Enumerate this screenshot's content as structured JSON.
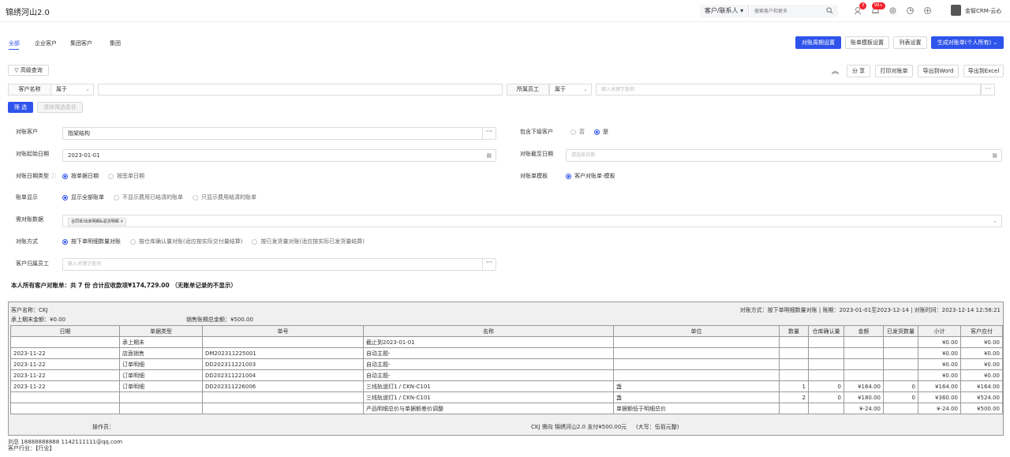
{
  "app": {
    "title": "锦绣河山2.0"
  },
  "topbar": {
    "search_type": "客户/联系人",
    "search_placeholder": "搜索客户和更多",
    "badge_todo": "3",
    "badge_notice": "99+",
    "user_name": "金智CRM-云心"
  },
  "tabs": [
    "全部",
    "企业客户",
    "集团客户",
    "集团"
  ],
  "actions": {
    "period_settings": "对账周期设置",
    "template_settings": "账单模板设置",
    "list_settings": "列表设置",
    "generate": "生成对账单(个人所有)",
    "advanced_query": "高级查询",
    "share": "分 享",
    "print": "打印对账单",
    "export_word": "导出到Word",
    "export_excel": "导出到Excel"
  },
  "filters": {
    "customer_label": "客户名称",
    "customer_op": "属于",
    "staff_label": "所属员工",
    "staff_op": "属于",
    "staff_placeholder": "输入关键字查询",
    "filter_btn": "筛 选",
    "clear_btn": "清除筛选条件"
  },
  "form": {
    "customer_label": "对账客户",
    "customer_value": "指架结构",
    "include_sub_label": "包含下级客户",
    "include_sub_no": "否",
    "include_sub_yes": "是",
    "start_date_label": "对账起始日期",
    "start_date_value": "2023-01-01",
    "end_date_label": "对账截至日期",
    "end_date_placeholder": "请选择日期",
    "date_type_label": "对账日期类型",
    "date_type_opt1": "按单据日期",
    "date_type_opt2": "按签单日期",
    "template_label": "对账单模板",
    "template_value": "客户对账单-模板",
    "display_label": "账单显示",
    "display_opt1": "显示全部账单",
    "display_opt2": "不显示费用已结清的账单",
    "display_opt3": "只显示费用结清的账单",
    "data_label": "需对账数据",
    "data_tag": "合同单/出库明细&退货明细",
    "method_label": "对账方式",
    "method_opt1": "按下单明细数量对账",
    "method_opt2": "按仓库确认量对账(适应按实际交付量结算)",
    "method_opt3": "按已发货量对账(适应按实际已发货量结算)",
    "owner_label": "客户归属员工",
    "owner_placeholder": "输入关键字查询"
  },
  "summary": "本人所有客户对账单：共 7 份  合计应收款项¥174,729.00  （无账单记录的不显示）",
  "statement": {
    "customer": "客户名称：CKJ",
    "method_info": "对账方式：按下单明细数量对账 | 账期：2023-01-01至2023-12-14 | 对账时间：2023-12-14 12:58:21",
    "prev_balance": "承上期末金额：¥0.00",
    "total_sales": "销售账期总金额：¥500.00",
    "headers": [
      "日期",
      "单据类型",
      "单号",
      "名称",
      "单位",
      "数量",
      "仓库确认量",
      "金额",
      "已发货数量",
      "小计",
      "客户应付"
    ],
    "rows": [
      [
        "",
        "承上期末",
        "",
        "截止到2023-01-01",
        "",
        "",
        "",
        "",
        "",
        "¥0.00",
        "¥0.00"
      ],
      [
        "2023-11-22",
        "店面销售",
        "DM202311225001",
        "自动主题-",
        "",
        "",
        "",
        "",
        "",
        "¥0.00",
        "¥0.00"
      ],
      [
        "2023-11-22",
        "订单明细",
        "DD202311221003",
        "自动主题-",
        "",
        "",
        "",
        "",
        "",
        "¥0.00",
        "¥0.00"
      ],
      [
        "2023-11-22",
        "订单明细",
        "DD202311221004",
        "自动主题-",
        "",
        "",
        "",
        "",
        "",
        "¥0.00",
        "¥0.00"
      ],
      [
        "2023-11-22",
        "订单明细",
        "DD202311226006",
        "三线轨道灯1 / CKN-C101",
        "盏",
        "1",
        "0",
        "¥164.00",
        "0",
        "¥164.00",
        "¥164.00"
      ],
      [
        "",
        "",
        "",
        "三线轨道灯1 / CKN-C101",
        "盏",
        "2",
        "0",
        "¥180.00",
        "0",
        "¥360.00",
        "¥524.00"
      ],
      [
        "",
        "",
        "",
        "产品明细总价与单据额差价调整",
        "单据额低于明细总价",
        "",
        "",
        "¥-24.00",
        "",
        "¥-24.00",
        "¥500.00"
      ]
    ],
    "operator": "操作员：",
    "payment": "CKJ 需向 锦绣河山2.0 支付¥500.00元",
    "payment_caps": "(大写：伍佰元整)"
  },
  "contact": {
    "line1": "刘总  18888888888    1142111111@qq.com",
    "line2": "客户行业：【行业】"
  },
  "colors": {
    "primary": "#2f54eb",
    "danger": "#f5222d"
  }
}
